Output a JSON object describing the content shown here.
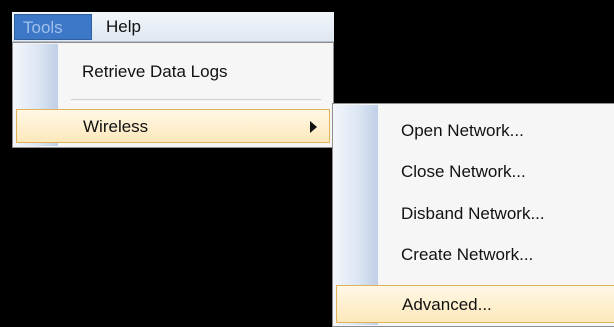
{
  "menubar": {
    "items": [
      {
        "label": "Tools"
      },
      {
        "label": "Help"
      }
    ]
  },
  "tools_menu": {
    "items": [
      {
        "label": "Retrieve Data Logs"
      },
      {
        "label": "Wireless"
      }
    ]
  },
  "wireless_submenu": {
    "items": [
      {
        "label": "Open Network..."
      },
      {
        "label": "Close Network..."
      },
      {
        "label": "Disband Network..."
      },
      {
        "label": "Create Network..."
      },
      {
        "label": "Advanced..."
      }
    ]
  },
  "colors": {
    "highlight_fill": "#fde8bb",
    "highlight_border": "#e0b35a",
    "menubar_active": "#3d78c8",
    "background": "#000000"
  }
}
